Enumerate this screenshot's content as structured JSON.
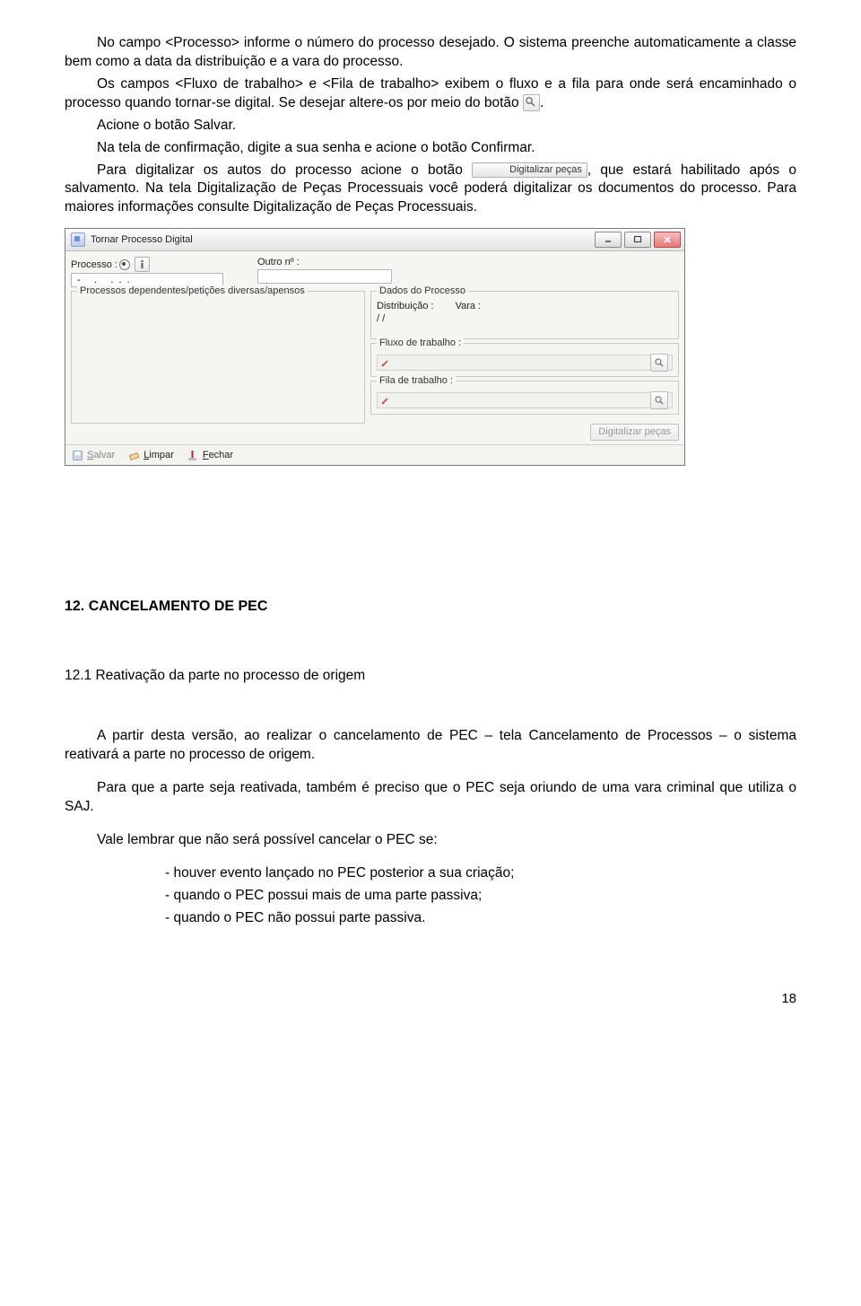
{
  "para1": "No campo <Processo> informe o número do processo desejado. O sistema preenche automaticamente a classe bem como a data da distribuição e a vara do processo.",
  "para2a": "Os campos <Fluxo de trabalho> e <Fila de trabalho> exibem o fluxo e a fila para onde será encaminhado o processo quando tornar-se digital. Se desejar altere-os por meio do botão ",
  "para2b": ".",
  "para3": "Acione o botão Salvar.",
  "para4": "Na tela de confirmação, digite a sua senha e acione o botão Confirmar.",
  "para5a": "Para digitalizar os autos do processo acione o botão ",
  "btn_digitalizar_inline": "Digitalizar peças",
  "para5b": ", que estará habilitado após o salvamento. Na tela Digitalização de Peças Processuais você poderá digitalizar os documentos do processo. Para maiores informações consulte Digitalização de Peças Processuais.",
  "window": {
    "title": "Tornar Processo Digital",
    "processo_label": "Processo :",
    "outro_label": "Outro nº :",
    "processo_value": " -     .     .  .  .",
    "left_legend": "Processos dependentes/petições diversas/apensos",
    "dados_legend": "Dados do Processo",
    "distrib_label": "Distribuição :",
    "distrib_value": "  /  /",
    "vara_label": "Vara :",
    "fluxo_legend": "Fluxo de trabalho :",
    "fila_legend": "Fila de trabalho :",
    "digitalizar_btn": "Digitalizar peças",
    "salvar": "Salvar",
    "limpar": "Limpar",
    "fechar": "Fechar"
  },
  "section_head": "12. CANCELAMENTO DE PEC",
  "subhead": "12.1 Reativação da parte no processo de origem",
  "para8": "A partir desta versão, ao realizar o cancelamento de PEC – tela Cancelamento de Processos – o sistema reativará a parte no processo de origem.",
  "para9": "Para que a parte seja reativada, também é preciso que o PEC seja oriundo de uma vara criminal que utiliza o SAJ.",
  "para10": "Vale lembrar que não será possível cancelar o PEC se:",
  "li1": "- houver evento lançado no PEC posterior a sua criação;",
  "li2": "- quando o PEC possui mais de uma parte passiva;",
  "li3": "- quando o PEC não possui parte passiva.",
  "pagenum": "18"
}
